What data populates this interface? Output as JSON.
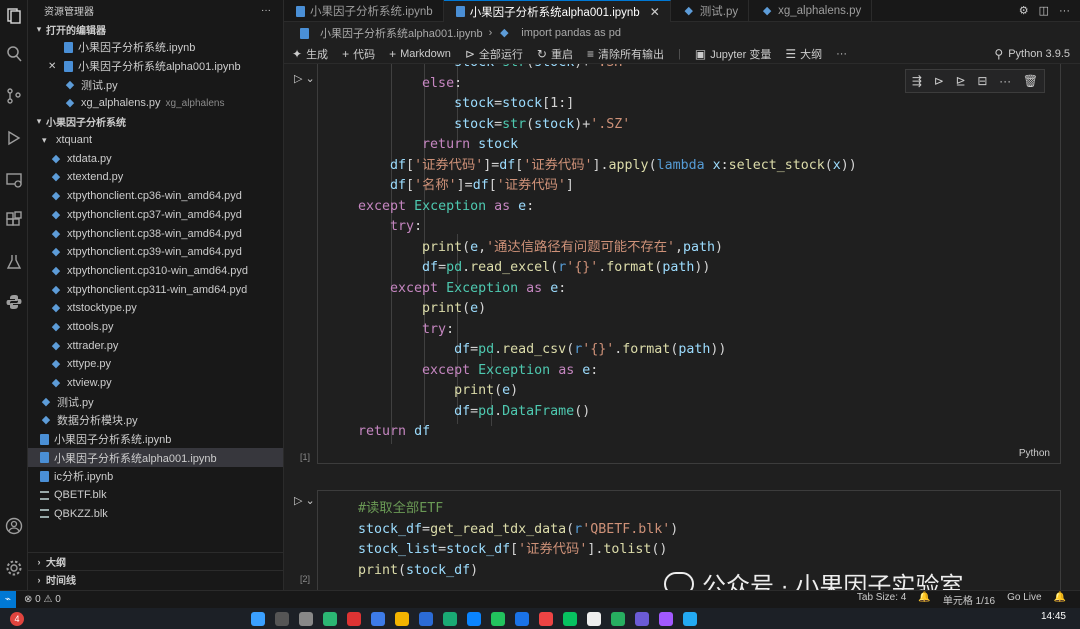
{
  "explorer": {
    "title": "资源管理器",
    "more": "···",
    "open_editors_label": "打开的编辑器",
    "open_editors": [
      {
        "name": "小果因子分析系统.ipynb",
        "type": "nb",
        "close": ""
      },
      {
        "name": "小果因子分析系统alpha001.ipynb",
        "type": "nb",
        "close": "✕"
      },
      {
        "name": "测试.py",
        "type": "py",
        "close": ""
      },
      {
        "name": "xg_alphalens.py",
        "type": "py",
        "close": "",
        "hint": "xg_alphalens"
      }
    ],
    "folder_label": "小果因子分析系统",
    "subfolder_label": "xtquant",
    "xtquant_files": [
      "xtdata.py",
      "xtextend.py",
      "xtpythonclient.cp36-win_amd64.pyd",
      "xtpythonclient.cp37-win_amd64.pyd",
      "xtpythonclient.cp38-win_amd64.pyd",
      "xtpythonclient.cp39-win_amd64.pyd",
      "xtpythonclient.cp310-win_amd64.pyd",
      "xtpythonclient.cp311-win_amd64.pyd",
      "xtstocktype.py",
      "xttools.py",
      "xttrader.py",
      "xttype.py",
      "xtview.py"
    ],
    "root_files": [
      {
        "name": "测试.py",
        "type": "py"
      },
      {
        "name": "数据分析模块.py",
        "type": "py"
      },
      {
        "name": "小果因子分析系统.ipynb",
        "type": "nb"
      },
      {
        "name": "小果因子分析系统alpha001.ipynb",
        "type": "nb",
        "selected": true
      },
      {
        "name": "ic分析.ipynb",
        "type": "nb"
      },
      {
        "name": "QBETF.blk",
        "type": "blk"
      },
      {
        "name": "QBKZZ.blk",
        "type": "blk"
      }
    ],
    "outline_label": "大纲",
    "timeline_label": "时间线"
  },
  "tabs": [
    {
      "label": "小果因子分析系统.ipynb",
      "active": false
    },
    {
      "label": "小果因子分析系统alpha001.ipynb",
      "active": true
    },
    {
      "label": "测试.py",
      "active": false
    },
    {
      "label": "xg_alphalens.py",
      "active": false
    }
  ],
  "breadcrumb": {
    "file": "小果因子分析系统alpha001.ipynb",
    "sep": "›",
    "item": "import pandas as pd"
  },
  "toolbar": {
    "generate": "生成",
    "code": "代码",
    "markdown": "Markdown",
    "run_all": "全部运行",
    "restart": "重启",
    "clear_outputs": "清除所有输出",
    "jupyter_vars": "Jupyter 变量",
    "outline": "大纲",
    "more": "···",
    "kernel": "Python 3.9.5"
  },
  "cell1": {
    "number": "[1]",
    "language": "Python"
  },
  "cell2": {
    "number": "[2]"
  },
  "status": {
    "errors": "0",
    "warnings": "0",
    "tab_size": "Tab Size: 4",
    "cell": "单元格 1/16",
    "go_live": "Go Live"
  },
  "watermark": {
    "text": "公众号 · 小果因子实验室"
  },
  "clock": "14:45",
  "notif_badge": "4",
  "colors": {
    "accent": "#0078d4",
    "background": "#1f1f1f",
    "sidebar": "#181818"
  }
}
